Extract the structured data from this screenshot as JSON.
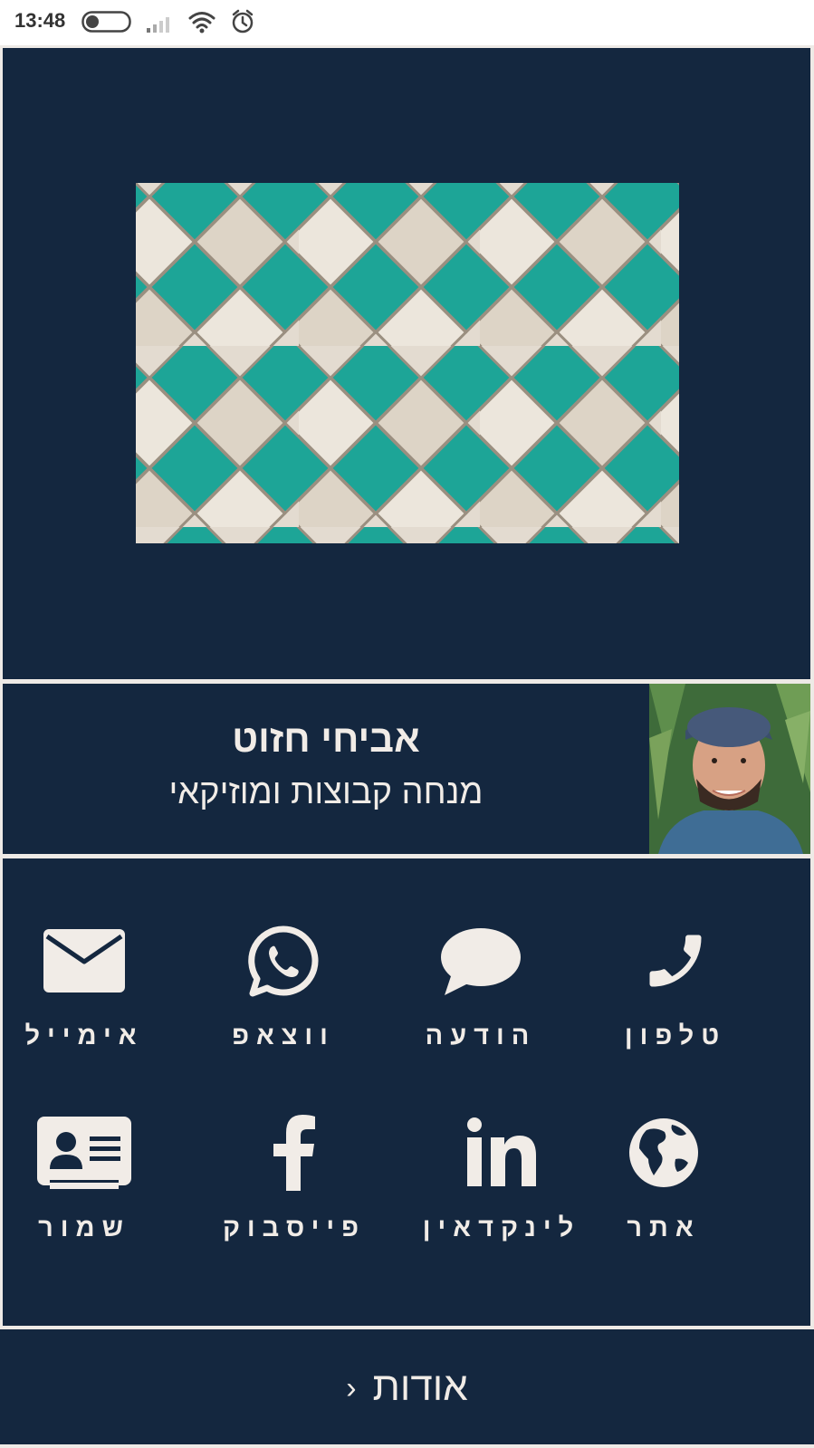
{
  "status_bar": {
    "time": "13:48"
  },
  "profile": {
    "name": "אביחי חזוט",
    "role": "מנחה קבוצות ומוזיקאי"
  },
  "actions": [
    {
      "id": "phone",
      "label": "טלפון",
      "icon": "phone-icon"
    },
    {
      "id": "message",
      "label": "הודעה",
      "icon": "speech-bubble-icon"
    },
    {
      "id": "whatsapp",
      "label": "ווצאפ",
      "icon": "whatsapp-icon"
    },
    {
      "id": "email",
      "label": "אימייל",
      "icon": "envelope-icon"
    },
    {
      "id": "website",
      "label": "אתר",
      "icon": "globe-icon"
    },
    {
      "id": "linkedin",
      "label": "לינקדאין",
      "icon": "linkedin-icon"
    },
    {
      "id": "facebook",
      "label": "פייסבוק",
      "icon": "facebook-icon"
    },
    {
      "id": "save",
      "label": "שמור",
      "icon": "contact-card-icon"
    }
  ],
  "about": {
    "label": "אודות"
  },
  "colors": {
    "panel": "#14273f",
    "text": "#f1ece7",
    "frame": "#eeeae6",
    "tile_teal": "#1aa89a",
    "tile_cream": "#e8e1d7"
  }
}
